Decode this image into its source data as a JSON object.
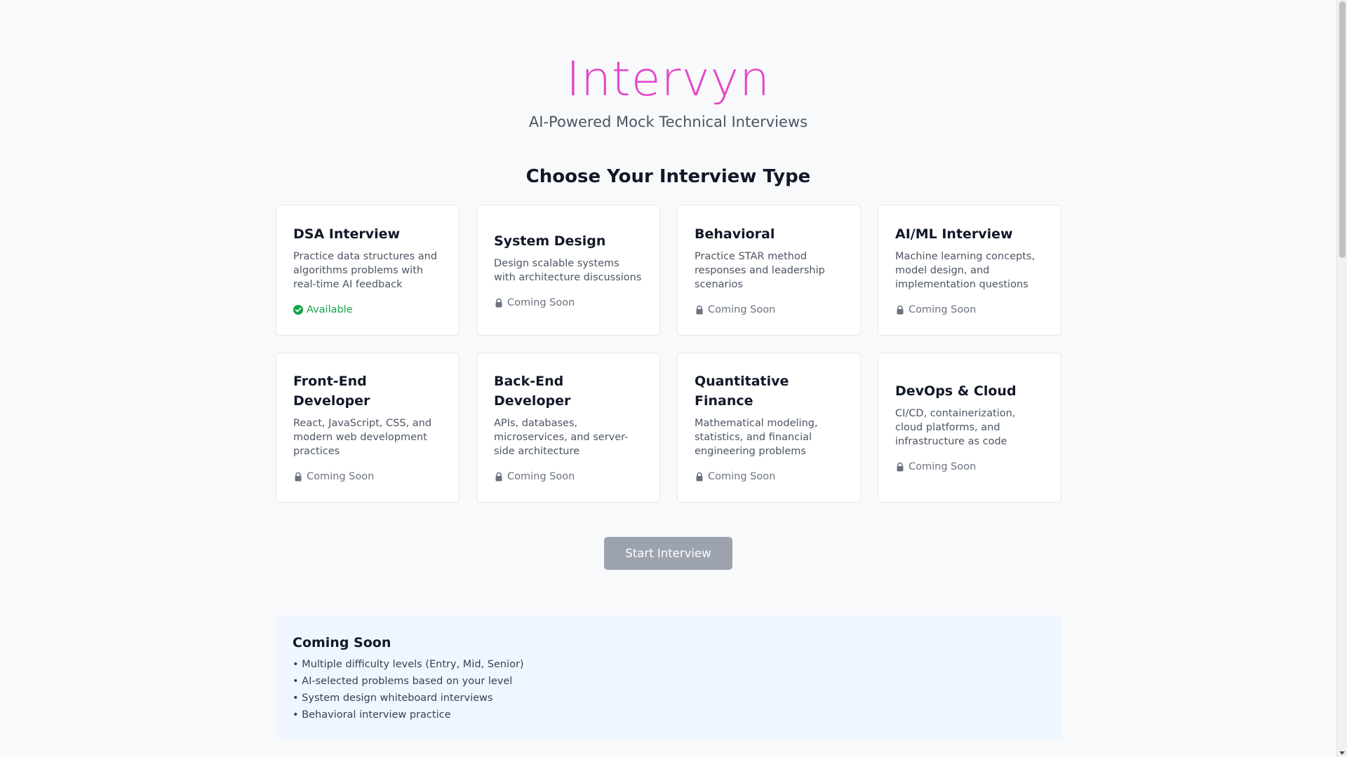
{
  "header": {
    "logo": "Intervyn",
    "tagline": "AI-Powered Mock Technical Interviews"
  },
  "section_title": "Choose Your Interview Type",
  "cards": [
    {
      "title": "DSA Interview",
      "description": "Practice data structures and algorithms problems with real-time AI feedback",
      "status": "Available",
      "available": true
    },
    {
      "title": "System Design",
      "description": "Design scalable systems with architecture discussions",
      "status": "Coming Soon",
      "available": false
    },
    {
      "title": "Behavioral",
      "description": "Practice STAR method responses and leadership scenarios",
      "status": "Coming Soon",
      "available": false
    },
    {
      "title": "AI/ML Interview",
      "description": "Machine learning concepts, model design, and implementation questions",
      "status": "Coming Soon",
      "available": false
    },
    {
      "title": "Front-End Developer",
      "description": "React, JavaScript, CSS, and modern web development practices",
      "status": "Coming Soon",
      "available": false
    },
    {
      "title": "Back-End Developer",
      "description": "APIs, databases, microservices, and server-side architecture",
      "status": "Coming Soon",
      "available": false
    },
    {
      "title": "Quantitative Finance",
      "description": "Mathematical modeling, statistics, and financial engineering problems",
      "status": "Coming Soon",
      "available": false
    },
    {
      "title": "DevOps & Cloud",
      "description": "CI/CD, containerization, cloud platforms, and infrastructure as code",
      "status": "Coming Soon",
      "available": false
    }
  ],
  "start_button": "Start Interview",
  "coming_soon": {
    "title": "Coming Soon",
    "items": [
      "• Multiple difficulty levels (Entry, Mid, Senior)",
      "• AI-selected problems based on your level",
      "• System design whiteboard interviews",
      "• Behavioral interview practice"
    ]
  },
  "colors": {
    "brand_gradient_start": "#d63ee0",
    "brand_gradient_end": "#f04cb0",
    "available": "#16a34a",
    "muted": "#6b7280",
    "button_disabled": "#9ca3af",
    "info_box": "#eff6ff"
  }
}
